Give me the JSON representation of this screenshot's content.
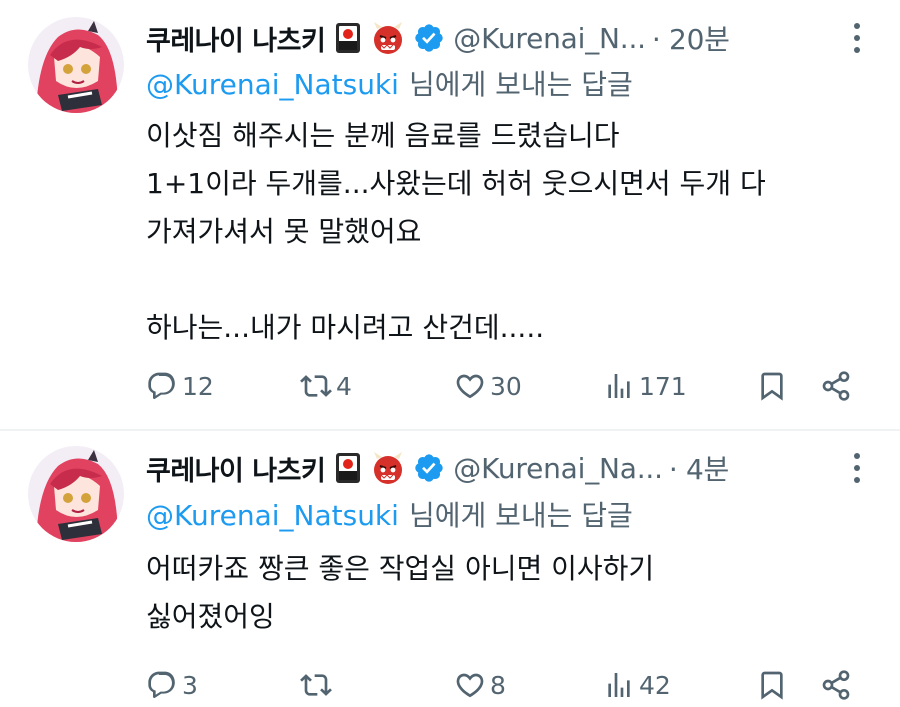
{
  "tweets": [
    {
      "display_name": "쿠레나이 나츠키",
      "handle": "@Kurenai_N...",
      "time": "· 20분",
      "reply_mention": "@Kurenai_Natsuki",
      "reply_suffix": "님에게 보내는 답글",
      "lines": [
        "이삿짐 해주시는 분께 음료를 드렸습니다",
        "1+1이라 두개를...사왔는데 허허 웃으시면서 두개 다",
        "가져가셔서 못 말했어요",
        "",
        "하나는...내가 마시려고 산건데....."
      ],
      "replies": "12",
      "retweets": "4",
      "likes": "30",
      "views": "171"
    },
    {
      "display_name": "쿠레나이 나츠키",
      "handle": "@Kurenai_Na...",
      "time": "· 4분",
      "reply_mention": "@Kurenai_Natsuki",
      "reply_suffix": "님에게 보내는 답글",
      "lines": [
        "어떠카죠 짱큰 좋은 작업실 아니면 이사하기",
        "싫어졌어잉"
      ],
      "replies": "3",
      "retweets": "",
      "likes": "8",
      "views": "42"
    }
  ],
  "icons": {
    "emoji_1": "japanese-hanafuda-icon",
    "emoji_2": "ogre-icon",
    "verified": "verified-badge-icon",
    "more": "more-vertical-icon",
    "reply": "reply-icon",
    "retweet": "retweet-icon",
    "like": "like-icon",
    "views": "views-icon",
    "bookmark": "bookmark-icon",
    "share": "share-icon"
  },
  "colors": {
    "text": "#0f1419",
    "muted": "#536471",
    "link": "#1d9bf0",
    "verified": "#1d9bf0",
    "divider": "#eff3f4"
  }
}
